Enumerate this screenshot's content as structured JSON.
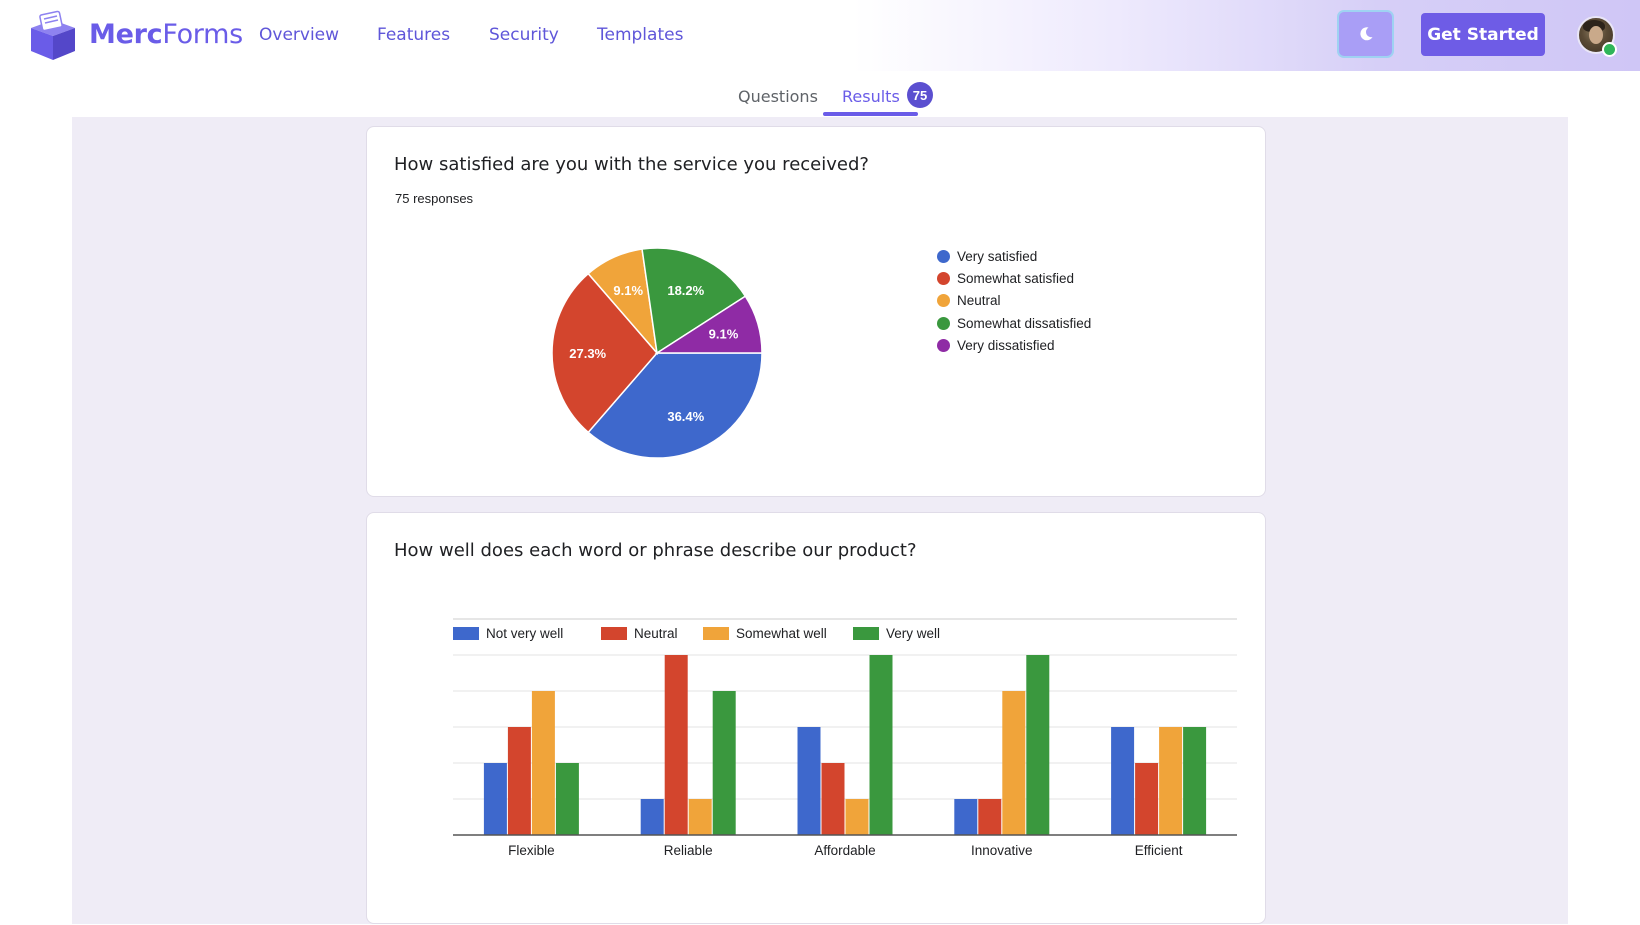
{
  "header": {
    "brand_bold": "Merc",
    "brand_light": "Forms",
    "nav": [
      "Overview",
      "Features",
      "Security",
      "Templates"
    ],
    "get_started": "Get Started",
    "theme_icon": "moon-icon",
    "colors": {
      "brand": "#6a5ce8",
      "button": "#6e5ce6"
    }
  },
  "tabs": {
    "questions": "Questions",
    "results": "Results",
    "results_count": "75"
  },
  "question1": {
    "title": "How satisfied are you with the service you received?",
    "responses": "75 responses"
  },
  "question2": {
    "title": "How well does each word or phrase describe our product?"
  },
  "chart_data": [
    {
      "type": "pie",
      "slices": [
        {
          "label": "Very satisfied",
          "value": 36.4,
          "label_text": "36.4%",
          "color": "#3e68cc"
        },
        {
          "label": "Somewhat satisfied",
          "value": 27.3,
          "label_text": "27.3%",
          "color": "#d3452d"
        },
        {
          "label": "Neutral",
          "value": 9.1,
          "label_text": "9.1%",
          "color": "#f0a43a"
        },
        {
          "label": "Somewhat dissatisfied",
          "value": 18.2,
          "label_text": "18.2%",
          "color": "#3a983e"
        },
        {
          "label": "Very dissatisfied",
          "value": 9.1,
          "label_text": "9.1%",
          "color": "#8f2ba5"
        }
      ],
      "legend_position": "right"
    },
    {
      "type": "bar",
      "categories": [
        "Flexible",
        "Reliable",
        "Affordable",
        "Innovative",
        "Efficient"
      ],
      "series": [
        {
          "name": "Not very well",
          "color": "#3e68cc",
          "values": [
            2,
            1,
            3,
            1,
            3
          ]
        },
        {
          "name": "Neutral",
          "color": "#d3452d",
          "values": [
            3,
            5,
            2,
            1,
            2
          ]
        },
        {
          "name": "Somewhat well",
          "color": "#f0a43a",
          "values": [
            4,
            1,
            1,
            4,
            3
          ]
        },
        {
          "name": "Very well",
          "color": "#3a983e",
          "values": [
            2,
            4,
            5,
            5,
            3
          ]
        }
      ],
      "ylim": [
        0,
        5
      ],
      "grid": true,
      "legend_position": "top-left"
    }
  ]
}
